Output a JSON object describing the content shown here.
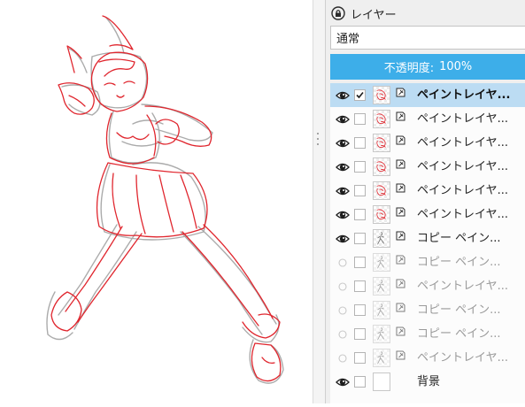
{
  "layers_panel": {
    "title": "レイヤー",
    "blend_mode": "通常",
    "opacity_label": "不透明度:",
    "opacity_value": "100%",
    "layers": [
      {
        "name": "ペイントレイヤ...",
        "visible": true,
        "checked": true,
        "active": true,
        "thumb": "red-sketch"
      },
      {
        "name": "ペイントレイヤ...",
        "visible": true,
        "checked": false,
        "active": false,
        "thumb": "red-sketch"
      },
      {
        "name": "ペイントレイヤ...",
        "visible": true,
        "checked": false,
        "active": false,
        "thumb": "red-sketch"
      },
      {
        "name": "ペイントレイヤ...",
        "visible": true,
        "checked": false,
        "active": false,
        "thumb": "red-sketch"
      },
      {
        "name": "ペイントレイヤ...",
        "visible": true,
        "checked": false,
        "active": false,
        "thumb": "red-sketch"
      },
      {
        "name": "ペイントレイヤ...",
        "visible": true,
        "checked": false,
        "active": false,
        "thumb": "red-sketch"
      },
      {
        "name": "コピー ペイン...",
        "visible": true,
        "checked": false,
        "active": false,
        "thumb": "gray-figure"
      },
      {
        "name": "コピー ペイン...",
        "visible": false,
        "checked": false,
        "active": false,
        "thumb": "gray-figure"
      },
      {
        "name": "ペイントレイヤ...",
        "visible": false,
        "checked": false,
        "active": false,
        "thumb": "gray-figure"
      },
      {
        "name": "コピー ペイン...",
        "visible": false,
        "checked": false,
        "active": false,
        "thumb": "gray-figure"
      },
      {
        "name": "コピー ペイン...",
        "visible": false,
        "checked": false,
        "active": false,
        "thumb": "gray-figure"
      },
      {
        "name": "ペイントレイヤ...",
        "visible": false,
        "checked": false,
        "active": false,
        "thumb": "gray-figure"
      },
      {
        "name": "背景",
        "visible": true,
        "checked": false,
        "active": false,
        "thumb": "white"
      }
    ]
  },
  "colors": {
    "accent": "#3daee9",
    "selected_row": "#bcdcf3",
    "sketch_red": "#e0262e",
    "sketch_gray": "#9a9a9a"
  }
}
